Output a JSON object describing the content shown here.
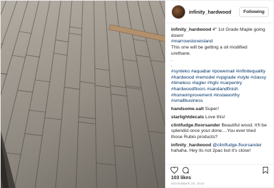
{
  "post": {
    "username": "infinity_hardwood",
    "follow_label": "Following",
    "caption": {
      "author": "infinity_hardwood",
      "line1": "4\" 1st Grade Maple going down!",
      "tag_line": "#marrowstoneisland",
      "line2": "This one will be getting a oil modified urethane.",
      "dot1": ".",
      "dot2": ".",
      "tags": "#synteko #aquabar #powernail #infinitequality #hardwood #remodel #upgrade #style #classy #timeless #lagler #hgtv #carpentry #hardwoodfloors #sandandfinish #homeimprovement #instaworthy #smallbusiness"
    },
    "comments": [
      {
        "user": "handsome.salt",
        "text": "Super!"
      },
      {
        "user": "starlightdecals",
        "text": "Love this!"
      },
      {
        "user": "clintfudge.floorsander",
        "text": "Beautiful wood. It'll be splendid once your done....You ever tried those Rubio products?"
      },
      {
        "user": "infinity_hardwood",
        "mention": "@clintfudge.floorsander",
        "text": "hahaha. Hey its not 2pac but it's close!"
      }
    ],
    "likes": "103 likes",
    "date": "NOVEMBER 29, 2016",
    "icons": [
      "heart-icon",
      "comment-icon",
      "bookmark-icon",
      "more-icon"
    ]
  }
}
